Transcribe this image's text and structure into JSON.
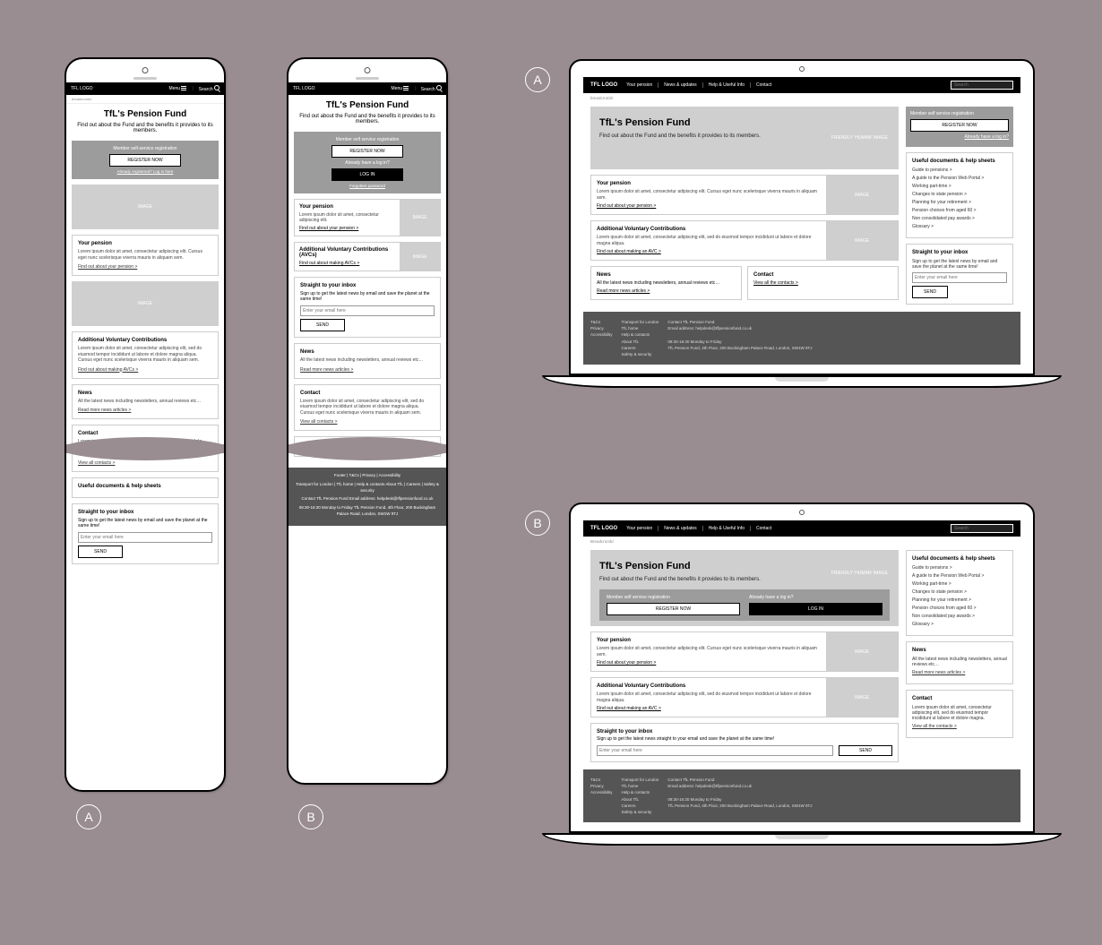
{
  "logo": "TFL LOGO",
  "mobile_menu": "Menu",
  "mobile_search": "Search",
  "breadcrumb_m": "breadcrumb/",
  "breadcrumb_d": "breadcrumb/",
  "breadcrumb_d_b": "Breadcrumb/",
  "title": "TfL's Pension Fund",
  "tagline": "Find out about the Fund and the benefits it provides to its members.",
  "reg": {
    "title_a": "Member self-service registration",
    "title_b": "Member self service registration",
    "register": "REGISTER NOW",
    "already_a": "Already registered? Log in here",
    "already_b": "Already have a log in?",
    "login": "LOG IN",
    "forgot": "Forgotten password"
  },
  "image_label": "IMAGE",
  "hero_image_label": "FRIENDLY 'HUMAN' IMAGE",
  "pension": {
    "h": "Your pension",
    "p": "Lorem ipsum dolor sit amet, consectetur adipiscing elit. Cursus eget nunc scelerisque viverra mauris in aliquam sem.",
    "link": "Find out about your pension >",
    "link_short": "Find out about your pension >"
  },
  "avc": {
    "h_long": "Additional Voluntary Contributions",
    "h_short": "Additional Voluntary Contributions (AVCs)",
    "p": "Lorem ipsum dolor sit amet, consectetur adipiscing elit, sed do eiusmod tempor incididunt ut labore et dolore magna aliqua. Cursus eget nunc scelerisque viverra mauris in aliquam sem.",
    "p_short": "Lorem ipsum dolor sit amet, consectetur adipiscing elit, sed do eiusmod tempor incididunt ut labore et dolore magna aliqua.",
    "link": "Find out about making AVCs >",
    "link_alt": "Find out about making an AVC >"
  },
  "news": {
    "h": "News",
    "p": "All the latest news including newsletters, annual reviews etc…",
    "link": "Read more news articles >"
  },
  "contact": {
    "h": "Contact",
    "p": "Lorem ipsum dolor sit amet, consectetur adipiscing elit, sed do eiusmod tempor incididunt ut labore et dolore magna aliqua. Cursus eget nunc scelerisque viverra mauris in aliquam sem.",
    "p_short": "Lorem ipsum dolor sit amet, consectetur adipiscing elit, sed do eiusmod tempor incididunt ut labore et dolore magna.",
    "link": "View all contacts >",
    "link_alt": "View all the contacts >"
  },
  "docs": {
    "h": "Useful documents & help sheets",
    "items": [
      "Guide to pensions >",
      "A guide to the Pension Web Portal >",
      "Working part-time >",
      "Changes to state pension >",
      "Planning for your retirement >",
      "Pension choices from aged 60 >",
      "Non consolidated pay awards >",
      "Glossary >"
    ]
  },
  "inbox": {
    "h": "Straight to your inbox",
    "p": "Sign up to get the latest news by email and save the planet at the same time!",
    "p_wide": "Sign up to get the latest news straight to your email and save the planet at the same time!",
    "placeholder": "Enter your email here",
    "send": "SEND"
  },
  "nav": {
    "yp": "Your pension",
    "news": "News & updates",
    "help": "Help & Useful Info",
    "contact": "Contact",
    "search_ph": "Search"
  },
  "footer_m": {
    "row1": "Footer  |  T&Cs  |  Privacy  |  Accessibility",
    "row2": "Transport for London  |  TfL home  |  Help & contacts  About TfL  |  Careers  |  Safety & security",
    "row3": "Contact TfL Pension Fund  Email address: helpdesk@tflpensionfund.co.uk",
    "row4": "08:30-16:30 Monday to Friday  TfL Pension Fund, 4th Floor, 200 Buckingham Palace Road, London, SW1W 9TJ"
  },
  "footer_d": {
    "c1": "T&Cs\nPrivacy\nAccessibility",
    "c2": "Transport for London\nTfL home\nHelp & contacts\nAbout TfL\nCareers\nSafety & security",
    "c3": "Contact TfL Pension Fund\nEmail address: helpdesk@tflpensionfund.co.uk\n\n08:30-16:30 Monday to Friday\nTfL Pension Fund, 4th Floor, 200 Buckingham Palace Road, London, SW1W 9TJ"
  },
  "badges": {
    "a": "A",
    "b": "B"
  }
}
